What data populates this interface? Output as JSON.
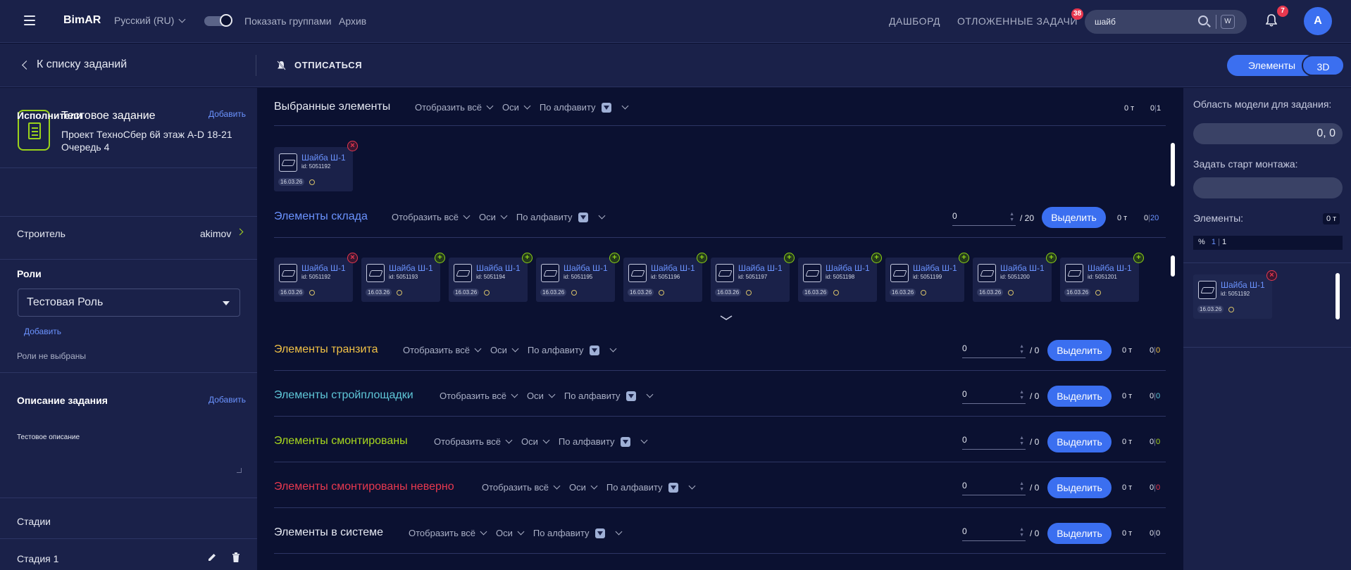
{
  "topbar": {
    "brand": "BimAR",
    "language": "Русский (RU)",
    "show_groups": "Показать группами",
    "archive": "Архив",
    "dashboard": "ДАШБОРД",
    "deferred": "ОТЛОЖЕННЫЕ ЗАДАЧИ",
    "deferred_badge": "38",
    "search_value": "шайб",
    "search_kbd": "W",
    "notif_badge": "7",
    "avatar": "A"
  },
  "subbar": {
    "back": "К списку заданий",
    "unsubscribe": "ОТПИСАТЬСЯ",
    "elements_btn": "Элементы",
    "btn_3d": "3D"
  },
  "sidebar": {
    "task_title": "Тестовое задание",
    "task_project": "Проект ТехноСбер 6й этаж A-D 18-21",
    "task_queue": "Очередь 4",
    "executors_title": "Исполнители",
    "executors_add": "Добавить",
    "builder_label": "Строитель",
    "builder_value": "akimov",
    "roles_title": "Роли",
    "role_selected": "Тестовая Роль",
    "roles_add": "Добавить",
    "roles_empty": "Роли не выбраны",
    "desc_title": "Описание задания",
    "desc_add": "Добавить",
    "desc_text": "Тестовое описание",
    "stages_title": "Стадии",
    "stage1": "Стадия 1"
  },
  "controls": {
    "show_all": "Отобразить всё",
    "axes": "Оси",
    "alpha": "По алфавиту",
    "select_btn": "Выделить"
  },
  "sections": {
    "selected": {
      "title": "Выбранные элементы",
      "tons": "0 т",
      "count": "0",
      "total": "1"
    },
    "warehouse": {
      "title": "Элементы склада",
      "input": "0",
      "limit": "/ 20",
      "tons": "0 т",
      "count": "0",
      "total": "20"
    },
    "transit": {
      "title": "Элементы транзита",
      "input": "0",
      "limit": "/ 0",
      "tons": "0 т",
      "count": "0",
      "total": "0"
    },
    "site": {
      "title": "Элементы стройплощадки",
      "input": "0",
      "limit": "/ 0",
      "tons": "0 т",
      "count": "0",
      "total": "0"
    },
    "mounted": {
      "title": "Элементы смонтированы",
      "input": "0",
      "limit": "/ 0",
      "tons": "0 т",
      "count": "0",
      "total": "0"
    },
    "wrong": {
      "title": "Элементы смонтированы неверно",
      "input": "0",
      "limit": "/ 0",
      "tons": "0 т",
      "count": "0",
      "total": "0"
    },
    "system": {
      "title": "Элементы в системе",
      "input": "0",
      "limit": "/ 0",
      "tons": "0 т",
      "count": "0",
      "total": "0"
    }
  },
  "cards": {
    "name": "Шайба Ш-1",
    "date": "16.03.26",
    "selected_id": "id: 5051192",
    "warehouse_ids": [
      "id: 5051192",
      "id: 5051193",
      "id: 5051194",
      "id: 5051195",
      "id: 5051196",
      "id: 5051197",
      "id: 5051198",
      "id: 5051199",
      "id: 5051200",
      "id: 5051201"
    ]
  },
  "right": {
    "area_label": "Область модели для задания:",
    "area_value": "0, 0",
    "start_label": "Задать старт монтажа:",
    "elements_label": "Элементы:",
    "elements_tons": "0 т",
    "pct_label": "%",
    "pct_a": "1",
    "pct_b": "1",
    "card_id": "id: 5051192"
  },
  "colors": {
    "accent": "#3b6ff0",
    "green": "#a8d81e",
    "transit": "#f0c146",
    "site": "#5fc7d8",
    "mounted": "#a8d81e",
    "wrong": "#e8384f",
    "warehouse": "#6b93ff"
  }
}
